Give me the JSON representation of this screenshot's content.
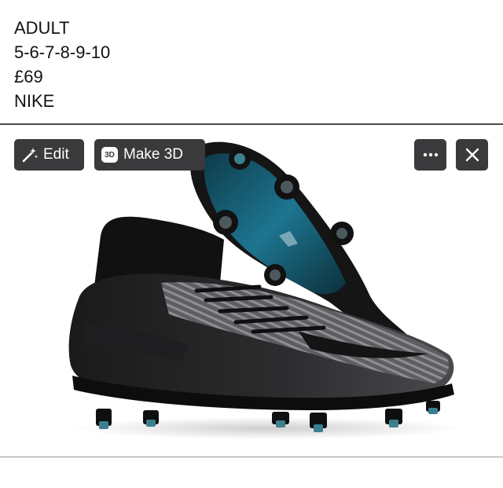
{
  "listing": {
    "lines": [
      "ADULT",
      "5-6-7-8-9-10",
      "£69",
      "NIKE"
    ]
  },
  "toolbar": {
    "edit_label": "Edit",
    "make3d_label": "Make 3D",
    "make3d_badge": "3D",
    "edit_icon": "magic-wand-icon",
    "more_icon": "ellipsis-icon",
    "close_icon": "close-icon"
  },
  "photo": {
    "subject": "football-boot-image",
    "colors": {
      "upper": "#2b2b2d",
      "sole_plate": "#1a6f8a",
      "studs": "#3c7f8f"
    }
  }
}
